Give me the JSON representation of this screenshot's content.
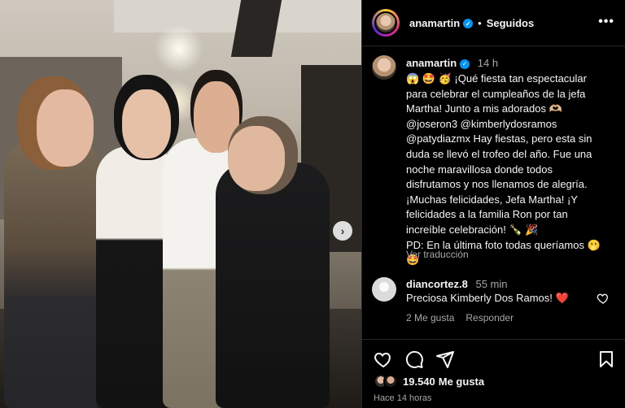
{
  "post": {
    "username": "ana​martin",
    "follow_status": "Seguidos",
    "more_icon": "more-horizontal-icon"
  },
  "caption": {
    "username": "anamartin",
    "time": "14 h",
    "text": "😱 🤩 🥳 ¡Qué fiesta tan espectacular\npara celebrar el cumpleaños de la jefa\nMartha! Junto a mis adorados 🫶🏼\n@joseron3 @kimberlydosramos\n@patydiazmx Hay fiestas, pero esta sin\nduda se llevó el trofeo del año. Fue una\nnoche maravillosa donde todos\ndisfrutamos y nos llenamos de alegría.\n¡Muchas felicidades, Jefa Martha! ¡Y\nfelicidades a la familia Ron por tan\nincreíble celebración! 🍾 🎉\nPD: En la última foto todas queríamos 🫢\n🤩",
    "translate": "Ver traducción"
  },
  "comment": {
    "username": "diancortez.8",
    "time": "55 min",
    "text": "Preciosa Kimberly Dos Ramos! ❤️",
    "likes": "2 Me gusta",
    "reply": "Responder"
  },
  "actions": {
    "icons": [
      "heart-icon",
      "comment-icon",
      "share-icon",
      "bookmark-icon"
    ]
  },
  "likes": {
    "count": "19.540",
    "label": "Me gusta"
  },
  "posted": "Hace 14 horas",
  "colors": {
    "background": "#000000",
    "verified": "#0095f6",
    "secondary_text": "#a8a8a8",
    "heart_red": "#ff3040"
  }
}
